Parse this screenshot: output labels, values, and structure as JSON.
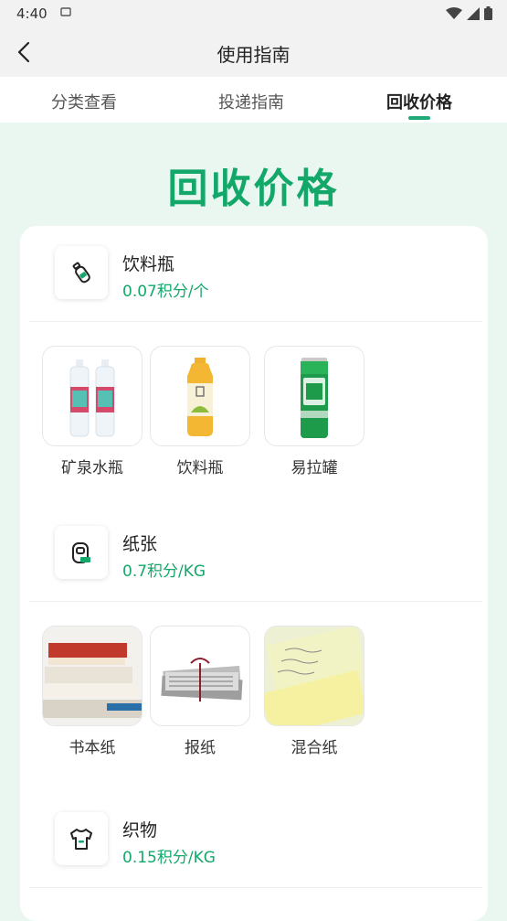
{
  "status": {
    "time": "4:40"
  },
  "header": {
    "title": "使用指南"
  },
  "tabs": [
    {
      "label": "分类查看"
    },
    {
      "label": "投递指南"
    },
    {
      "label": "回收价格"
    }
  ],
  "hero": {
    "title": "回收价格"
  },
  "categories": [
    {
      "name": "饮料瓶",
      "price": "0.07积分/个",
      "items": [
        {
          "label": "矿泉水瓶"
        },
        {
          "label": "饮料瓶"
        },
        {
          "label": "易拉罐"
        }
      ]
    },
    {
      "name": "纸张",
      "price": "0.7积分/KG",
      "items": [
        {
          "label": "书本纸"
        },
        {
          "label": "报纸"
        },
        {
          "label": "混合纸"
        }
      ]
    },
    {
      "name": "织物",
      "price": "0.15积分/KG",
      "items": []
    }
  ],
  "colors": {
    "accent": "#13a86a",
    "background": "#eaf6f0"
  }
}
